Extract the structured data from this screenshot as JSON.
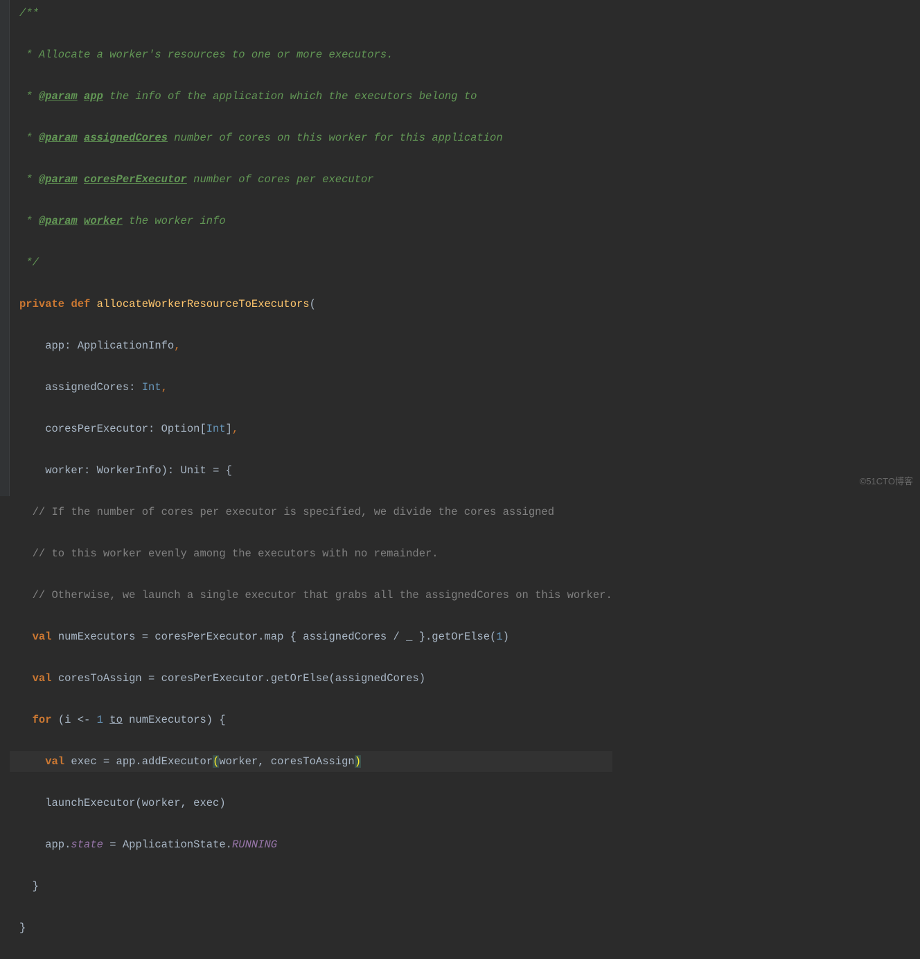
{
  "doc": {
    "open": "/**",
    "l1": " * Allocate a worker's resources to one or more executors.",
    "l2_pre": " * ",
    "l2_tag": "@param",
    "l2_name": "app",
    "l2_rest": " the info of the application which the executors belong to",
    "l3_pre": " * ",
    "l3_tag": "@param",
    "l3_name": "assignedCores",
    "l3_rest": " number of cores on this worker for this application",
    "l4_pre": " * ",
    "l4_tag": "@param",
    "l4_name": "coresPerExecutor",
    "l4_rest": " number of cores per executor",
    "l5_pre": " * ",
    "l5_tag": "@param",
    "l5_name": "worker",
    "l5_rest": " the worker info",
    "close": " */"
  },
  "sig": {
    "kw_private": "private",
    "kw_def": "def",
    "name": "allocateWorkerResourceToExecutors",
    "open": "(",
    "p1": "    app: ApplicationInfo",
    "comma": ",",
    "p2_pre": "    assignedCores: ",
    "p2_type": "Int",
    "p3_pre": "    coresPerExecutor: Option[",
    "p3_type": "Int",
    "p3_post": "]",
    "p4": "    worker: WorkerInfo): ",
    "unit": "Unit",
    "eq": " = {"
  },
  "cm": {
    "c1": "  // If the number of cores per executor is specified, we divide the cores assigned",
    "c2": "  // to this worker evenly among the executors with no remainder.",
    "c3": "  // Otherwise, we launch a single executor that grabs all the assignedCores on this worker."
  },
  "body": {
    "val": "val",
    "for": "for",
    "numExec_pre": " numExecutors = coresPerExecutor.map { assignedCores / _ }.getOrElse(",
    "one": "1",
    "close_paren": ")",
    "coresAssign": " coresToAssign = coresPerExecutor.getOrElse(assignedCores)",
    "for_open": " (i <- ",
    "for_one": "1",
    "to": "to",
    "for_rest": " numExecutors) {",
    "exec_pre": " exec = app.addExecutor",
    "exec_args": "worker, coresToAssign",
    "launch": "    launchExecutor(worker, exec)",
    "app_state_pre": "    app.",
    "state": "state",
    "app_state_mid": " = ApplicationState.",
    "running": "RUNNING",
    "brace_close1": "  }",
    "brace_close2": "}"
  },
  "watermark": "©51CTO博客"
}
